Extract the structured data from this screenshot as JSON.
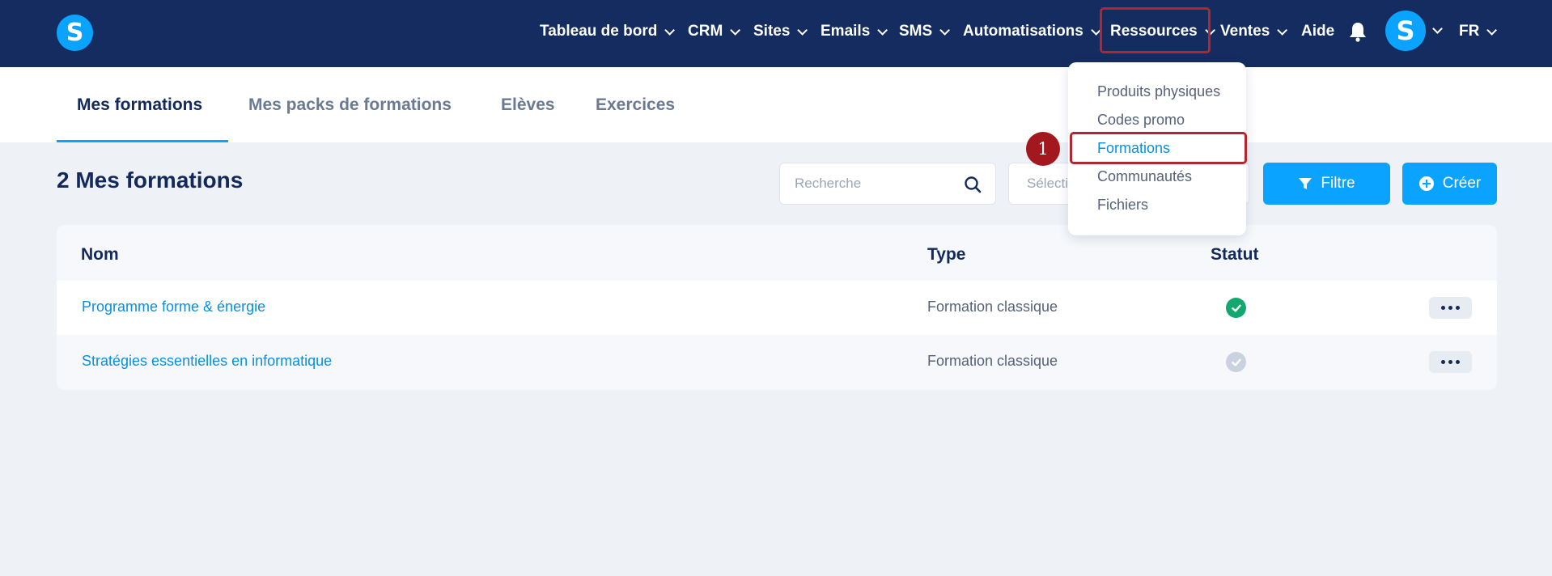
{
  "app": {
    "logo_letter": "S"
  },
  "nav": {
    "items": [
      {
        "label": "Tableau de bord",
        "has_chevron": true
      },
      {
        "label": "CRM",
        "has_chevron": true
      },
      {
        "label": "Sites",
        "has_chevron": true
      },
      {
        "label": "Emails",
        "has_chevron": true
      },
      {
        "label": "SMS",
        "has_chevron": true
      },
      {
        "label": "Automatisations",
        "has_chevron": true
      },
      {
        "label": "Ressources",
        "has_chevron": true,
        "highlighted": true
      },
      {
        "label": "Ventes",
        "has_chevron": true
      },
      {
        "label": "Aide",
        "has_chevron": false
      }
    ],
    "bell_icon": "bell-icon",
    "avatar_letter": "S",
    "language": "FR"
  },
  "tabs": [
    {
      "label": "Mes formations",
      "active": true
    },
    {
      "label": "Mes packs de formations",
      "active": false
    },
    {
      "label": "Elèves",
      "active": false
    },
    {
      "label": "Exercices",
      "active": false
    }
  ],
  "toolbar": {
    "title": "2 Mes formations",
    "search_placeholder": "Recherche",
    "select_placeholder": "Sélecti",
    "filter_label": "Filtre",
    "create_label": "Créer"
  },
  "table": {
    "headers": {
      "name": "Nom",
      "type": "Type",
      "status": "Statut"
    },
    "rows": [
      {
        "name": "Programme forme & énergie",
        "type": "Formation classique",
        "status": "published"
      },
      {
        "name": "Stratégies essentielles en informatique",
        "type": "Formation classique",
        "status": "draft"
      }
    ]
  },
  "dropdown": {
    "items": [
      {
        "label": "Produits physiques",
        "active": false
      },
      {
        "label": "Codes promo",
        "active": false
      },
      {
        "label": "Formations",
        "active": true,
        "highlighted": true
      },
      {
        "label": "Communautés",
        "active": false
      },
      {
        "label": "Fichiers",
        "active": false
      }
    ]
  },
  "annotation": {
    "step_number": "1"
  },
  "colors": {
    "navbar": "#142c5f",
    "accent": "#0aa3ff",
    "highlight": "#b3262d",
    "status_published": "#14a86e",
    "status_draft": "#c9d2de"
  }
}
